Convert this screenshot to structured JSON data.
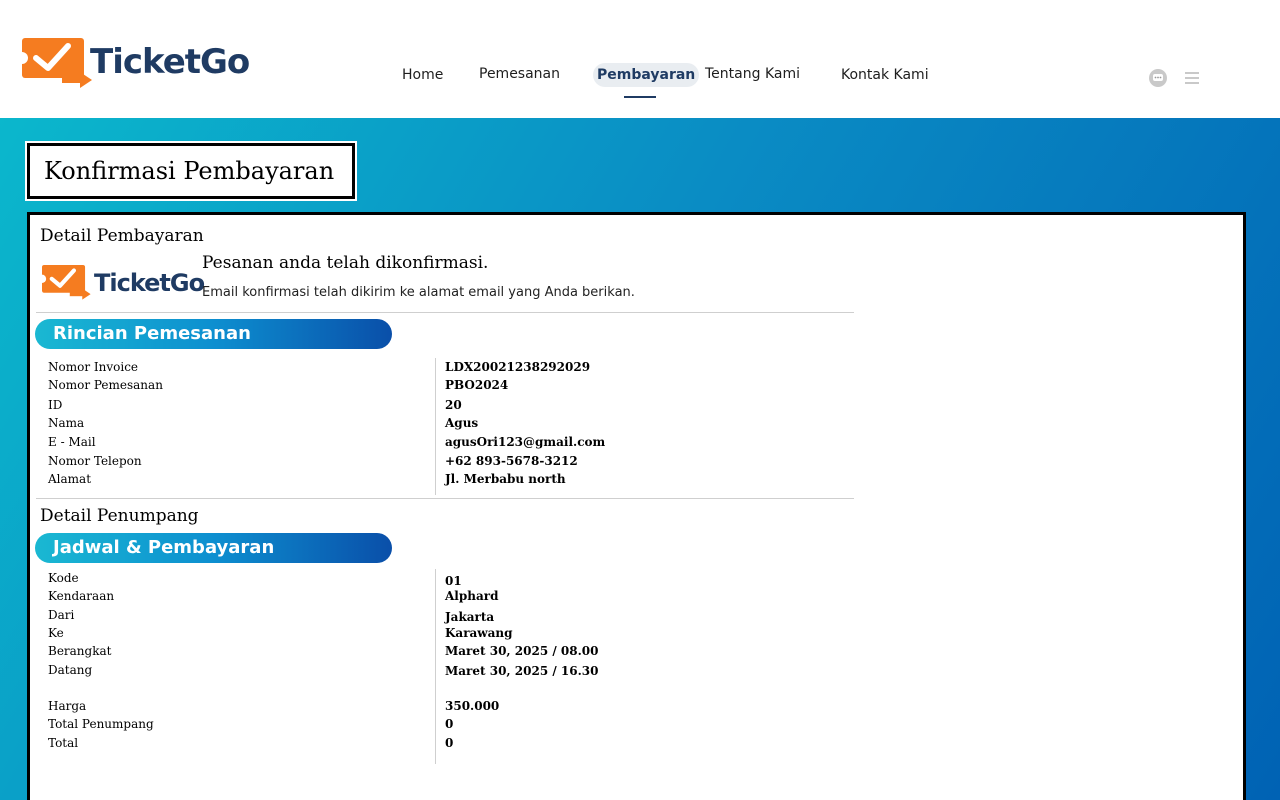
{
  "brand": {
    "name": "TicketGo"
  },
  "nav": {
    "home": "Home",
    "pemesanan": "Pemesanan",
    "pembayaran": "Pembayaran",
    "tentang": "Tentang Kami",
    "kontak": "Kontak Kami"
  },
  "icons": {
    "chat": "chat-icon",
    "menu": "menu-icon"
  },
  "colors": {
    "brand_orange": "#f57c20",
    "brand_navy": "#1f3b63",
    "band_start": "#0bb7cc",
    "band_end": "#0062b4"
  },
  "page_title": "Konfirmasi Pembayaran",
  "payment": {
    "heading": "Detail Pembayaran",
    "confirm_title": "Pesanan anda telah dikonfirmasi.",
    "confirm_sub": "Email konfirmasi telah dikirim ke alamat email yang Anda berikan."
  },
  "order": {
    "pill": "Rincian Pemesanan",
    "rows": [
      {
        "label": "Nomor Invoice",
        "value": "LDX20021238292029"
      },
      {
        "label": "Nomor Pemesanan",
        "value": "PBO2024"
      },
      {
        "label": "ID",
        "value": "20"
      },
      {
        "label": "Nama",
        "value": "Agus"
      },
      {
        "label": "E - Mail",
        "value": "agusOri123@gmail.com"
      },
      {
        "label": "Nomor Telepon",
        "value": "+62 893-5678-3212"
      },
      {
        "label": "Alamat",
        "value": "Jl. Merbabu north"
      }
    ]
  },
  "passenger": {
    "heading": "Detail Penumpang",
    "pill": "Jadwal  & Pembayaran",
    "rows": [
      {
        "label": "Kode",
        "value": "01"
      },
      {
        "label": "Kendaraan",
        "value": "Alphard"
      },
      {
        "label": "Dari",
        "value": "Jakarta"
      },
      {
        "label": "Ke",
        "value": "Karawang"
      },
      {
        "label": "Berangkat",
        "value": "Maret 30, 2025 / 08.00"
      },
      {
        "label": "Datang",
        "value": "Maret 30, 2025 / 16.30"
      },
      {
        "label": "Harga",
        "value": "350.000"
      },
      {
        "label": "Total Penumpang",
        "value": "0"
      },
      {
        "label": "Total",
        "value": "0"
      }
    ]
  }
}
